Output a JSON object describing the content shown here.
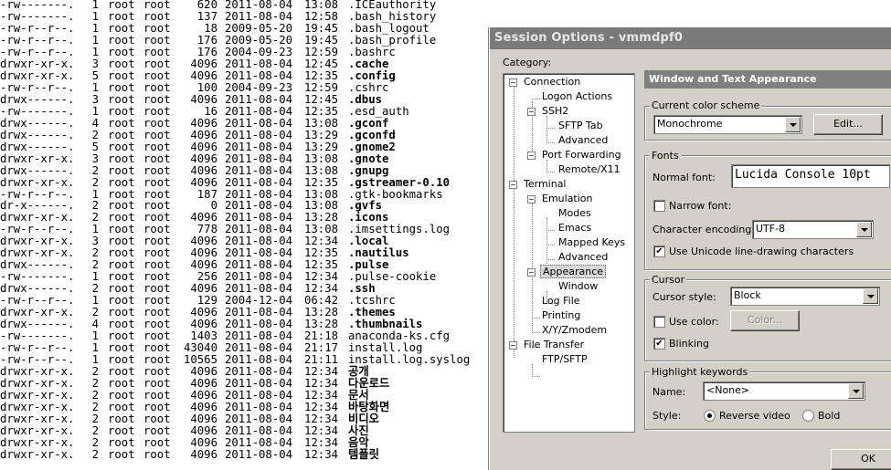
{
  "terminal": {
    "lines": [
      {
        "perm": "-rw-------.",
        "links": "1",
        "user": "root",
        "group": "root",
        "size": "620",
        "date": "2011-08-04",
        "time": "13:08",
        "name": ".ICEauthority",
        "bold": false
      },
      {
        "perm": "-rw-------.",
        "links": "1",
        "user": "root",
        "group": "root",
        "size": "137",
        "date": "2011-08-04",
        "time": "12:58",
        "name": ".bash_history",
        "bold": false
      },
      {
        "perm": "-rw-r--r--.",
        "links": "1",
        "user": "root",
        "group": "root",
        "size": "18",
        "date": "2009-05-20",
        "time": "19:45",
        "name": ".bash_logout",
        "bold": false
      },
      {
        "perm": "-rw-r--r--.",
        "links": "1",
        "user": "root",
        "group": "root",
        "size": "176",
        "date": "2009-05-20",
        "time": "19:45",
        "name": ".bash_profile",
        "bold": false
      },
      {
        "perm": "-rw-r--r--.",
        "links": "1",
        "user": "root",
        "group": "root",
        "size": "176",
        "date": "2004-09-23",
        "time": "12:59",
        "name": ".bashrc",
        "bold": false
      },
      {
        "perm": "drwxr-xr-x.",
        "links": "3",
        "user": "root",
        "group": "root",
        "size": "4096",
        "date": "2011-08-04",
        "time": "12:45",
        "name": ".cache",
        "bold": true
      },
      {
        "perm": "drwxr-xr-x.",
        "links": "5",
        "user": "root",
        "group": "root",
        "size": "4096",
        "date": "2011-08-04",
        "time": "12:35",
        "name": ".config",
        "bold": true
      },
      {
        "perm": "-rw-r--r--.",
        "links": "1",
        "user": "root",
        "group": "root",
        "size": "100",
        "date": "2004-09-23",
        "time": "12:59",
        "name": ".cshrc",
        "bold": false
      },
      {
        "perm": "drwx------.",
        "links": "3",
        "user": "root",
        "group": "root",
        "size": "4096",
        "date": "2011-08-04",
        "time": "12:45",
        "name": ".dbus",
        "bold": true
      },
      {
        "perm": "-rw-------.",
        "links": "1",
        "user": "root",
        "group": "root",
        "size": "16",
        "date": "2011-08-04",
        "time": "12:35",
        "name": ".esd_auth",
        "bold": false
      },
      {
        "perm": "drwx------.",
        "links": "4",
        "user": "root",
        "group": "root",
        "size": "4096",
        "date": "2011-08-04",
        "time": "13:08",
        "name": ".gconf",
        "bold": true
      },
      {
        "perm": "drwx------.",
        "links": "2",
        "user": "root",
        "group": "root",
        "size": "4096",
        "date": "2011-08-04",
        "time": "13:29",
        "name": ".gconfd",
        "bold": true
      },
      {
        "perm": "drwx------.",
        "links": "5",
        "user": "root",
        "group": "root",
        "size": "4096",
        "date": "2011-08-04",
        "time": "13:29",
        "name": ".gnome2",
        "bold": true
      },
      {
        "perm": "drwxr-xr-x.",
        "links": "3",
        "user": "root",
        "group": "root",
        "size": "4096",
        "date": "2011-08-04",
        "time": "13:08",
        "name": ".gnote",
        "bold": true
      },
      {
        "perm": "drwx------.",
        "links": "2",
        "user": "root",
        "group": "root",
        "size": "4096",
        "date": "2011-08-04",
        "time": "13:08",
        "name": ".gnupg",
        "bold": true
      },
      {
        "perm": "drwxr-xr-x.",
        "links": "2",
        "user": "root",
        "group": "root",
        "size": "4096",
        "date": "2011-08-04",
        "time": "12:35",
        "name": ".gstreamer-0.10",
        "bold": true
      },
      {
        "perm": "-rw-r--r--.",
        "links": "1",
        "user": "root",
        "group": "root",
        "size": "187",
        "date": "2011-08-04",
        "time": "13:08",
        "name": ".gtk-bookmarks",
        "bold": false
      },
      {
        "perm": "dr-x------.",
        "links": "2",
        "user": "root",
        "group": "root",
        "size": "0",
        "date": "2011-08-04",
        "time": "13:08",
        "name": ".gvfs",
        "bold": true
      },
      {
        "perm": "drwxr-xr-x.",
        "links": "2",
        "user": "root",
        "group": "root",
        "size": "4096",
        "date": "2011-08-04",
        "time": "13:28",
        "name": ".icons",
        "bold": true
      },
      {
        "perm": "-rw-r--r--.",
        "links": "1",
        "user": "root",
        "group": "root",
        "size": "778",
        "date": "2011-08-04",
        "time": "13:08",
        "name": ".imsettings.log",
        "bold": false
      },
      {
        "perm": "drwxr-xr-x.",
        "links": "3",
        "user": "root",
        "group": "root",
        "size": "4096",
        "date": "2011-08-04",
        "time": "12:34",
        "name": ".local",
        "bold": true
      },
      {
        "perm": "drwxr-xr-x.",
        "links": "2",
        "user": "root",
        "group": "root",
        "size": "4096",
        "date": "2011-08-04",
        "time": "12:35",
        "name": ".nautilus",
        "bold": true
      },
      {
        "perm": "drwx------.",
        "links": "2",
        "user": "root",
        "group": "root",
        "size": "4096",
        "date": "2011-08-04",
        "time": "12:35",
        "name": ".pulse",
        "bold": true
      },
      {
        "perm": "-rw-------.",
        "links": "1",
        "user": "root",
        "group": "root",
        "size": "256",
        "date": "2011-08-04",
        "time": "12:34",
        "name": ".pulse-cookie",
        "bold": false
      },
      {
        "perm": "drwx------.",
        "links": "2",
        "user": "root",
        "group": "root",
        "size": "4096",
        "date": "2011-08-04",
        "time": "12:34",
        "name": ".ssh",
        "bold": true
      },
      {
        "perm": "-rw-r--r--.",
        "links": "1",
        "user": "root",
        "group": "root",
        "size": "129",
        "date": "2004-12-04",
        "time": "06:42",
        "name": ".tcshrc",
        "bold": false
      },
      {
        "perm": "drwxr-xr-x.",
        "links": "2",
        "user": "root",
        "group": "root",
        "size": "4096",
        "date": "2011-08-04",
        "time": "13:28",
        "name": ".themes",
        "bold": true
      },
      {
        "perm": "drwx------.",
        "links": "4",
        "user": "root",
        "group": "root",
        "size": "4096",
        "date": "2011-08-04",
        "time": "13:28",
        "name": ".thumbnails",
        "bold": true
      },
      {
        "perm": "-rw-------.",
        "links": "1",
        "user": "root",
        "group": "root",
        "size": "1403",
        "date": "2011-08-04",
        "time": "21:18",
        "name": "anaconda-ks.cfg",
        "bold": false
      },
      {
        "perm": "-rw-r--r--.",
        "links": "1",
        "user": "root",
        "group": "root",
        "size": "43040",
        "date": "2011-08-04",
        "time": "21:17",
        "name": "install.log",
        "bold": false
      },
      {
        "perm": "-rw-r--r--.",
        "links": "1",
        "user": "root",
        "group": "root",
        "size": "10565",
        "date": "2011-08-04",
        "time": "21:11",
        "name": "install.log.syslog",
        "bold": false
      },
      {
        "perm": "drwxr-xr-x.",
        "links": "2",
        "user": "root",
        "group": "root",
        "size": "4096",
        "date": "2011-08-04",
        "time": "12:34",
        "name": "공개",
        "bold": true
      },
      {
        "perm": "drwxr-xr-x.",
        "links": "2",
        "user": "root",
        "group": "root",
        "size": "4096",
        "date": "2011-08-04",
        "time": "12:34",
        "name": "다운로드",
        "bold": true
      },
      {
        "perm": "drwxr-xr-x.",
        "links": "2",
        "user": "root",
        "group": "root",
        "size": "4096",
        "date": "2011-08-04",
        "time": "12:34",
        "name": "문서",
        "bold": true
      },
      {
        "perm": "drwxr-xr-x.",
        "links": "2",
        "user": "root",
        "group": "root",
        "size": "4096",
        "date": "2011-08-04",
        "time": "12:34",
        "name": "바탕화면",
        "bold": true
      },
      {
        "perm": "drwxr-xr-x.",
        "links": "2",
        "user": "root",
        "group": "root",
        "size": "4096",
        "date": "2011-08-04",
        "time": "12:34",
        "name": "비디오",
        "bold": true
      },
      {
        "perm": "drwxr-xr-x.",
        "links": "2",
        "user": "root",
        "group": "root",
        "size": "4096",
        "date": "2011-08-04",
        "time": "12:34",
        "name": "사진",
        "bold": true
      },
      {
        "perm": "drwxr-xr-x.",
        "links": "2",
        "user": "root",
        "group": "root",
        "size": "4096",
        "date": "2011-08-04",
        "time": "12:34",
        "name": "음악",
        "bold": true
      },
      {
        "perm": "drwxr-xr-x.",
        "links": "2",
        "user": "root",
        "group": "root",
        "size": "4096",
        "date": "2011-08-04",
        "time": "12:34",
        "name": "템플릿",
        "bold": true
      }
    ]
  },
  "dialog": {
    "title": "Session Options - vmmdpf0",
    "category_label": "Category:",
    "panel_title": "Window and Text Appearance",
    "tree": {
      "connection": "Connection",
      "logon_actions": "Logon Actions",
      "ssh2": "SSH2",
      "sftp_tab": "SFTP Tab",
      "ssh2_advanced": "Advanced",
      "port_forwarding": "Port Forwarding",
      "remote_x11": "Remote/X11",
      "terminal": "Terminal",
      "emulation": "Emulation",
      "modes": "Modes",
      "emacs": "Emacs",
      "mapped_keys": "Mapped Keys",
      "emulation_advanced": "Advanced",
      "appearance": "Appearance",
      "window": "Window",
      "log_file": "Log File",
      "printing": "Printing",
      "xyzmodem": "X/Y/Zmodem",
      "file_transfer": "File Transfer",
      "ftp_sftp": "FTP/SFTP"
    },
    "color_scheme": {
      "label": "Current color scheme",
      "value": "Monochrome",
      "edit_button": "Edit..."
    },
    "fonts": {
      "label": "Fonts",
      "normal_font_label": "Normal font:",
      "normal_font_value": "Lucida Console 10pt",
      "narrow_font_label": "Narrow font:",
      "narrow_font_checked": false,
      "encoding_label": "Character encoding:",
      "encoding_value": "UTF-8",
      "unicode_label": "Use Unicode line-drawing characters",
      "unicode_checked": true
    },
    "cursor": {
      "label": "Cursor",
      "style_label": "Cursor style:",
      "style_value": "Block",
      "use_color_label": "Use color:",
      "use_color_checked": false,
      "color_button": "Color...",
      "blinking_label": "Blinking",
      "blinking_checked": true
    },
    "highlight": {
      "label": "Highlight keywords",
      "name_label": "Name:",
      "name_value": "<None>",
      "style_label": "Style:",
      "reverse_video_label": "Reverse video",
      "reverse_video_selected": true,
      "bold_label": "Bold",
      "bold_selected": false
    },
    "ok_button": "OK"
  }
}
